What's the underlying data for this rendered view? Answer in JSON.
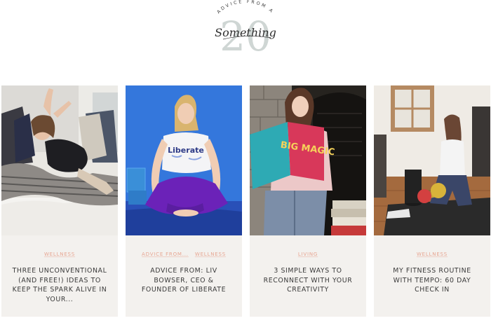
{
  "logo": {
    "arc_text": "ADVICE FROM A",
    "number": "20",
    "script": "Something"
  },
  "posts": [
    {
      "tags": [
        "WELLNESS"
      ],
      "title": "THREE UNCONVENTIONAL (AND FREE!) IDEAS TO KEEP THE SPARK ALIVE IN YOUR..."
    },
    {
      "tags": [
        "ADVICE FROM...",
        "WELLNESS"
      ],
      "title": "ADVICE FROM: LIV BOWSER, CEO & FOUNDER OF LIBERATE"
    },
    {
      "tags": [
        "LIVING"
      ],
      "title": "3 SIMPLE WAYS TO RECONNECT WITH YOUR CREATIVITY"
    },
    {
      "tags": [
        "WELLNESS"
      ],
      "title": "MY FITNESS ROUTINE WITH TEMPO: 60 DAY CHECK IN"
    }
  ],
  "images": {
    "card2_shirt_text": "Liberate",
    "card3_book_text": "BIG MAGIC"
  },
  "colors": {
    "tag": "#e7a591",
    "card_bg": "#f3f1ee",
    "title": "#3a3a3a",
    "logo": "#9aa8a4"
  }
}
